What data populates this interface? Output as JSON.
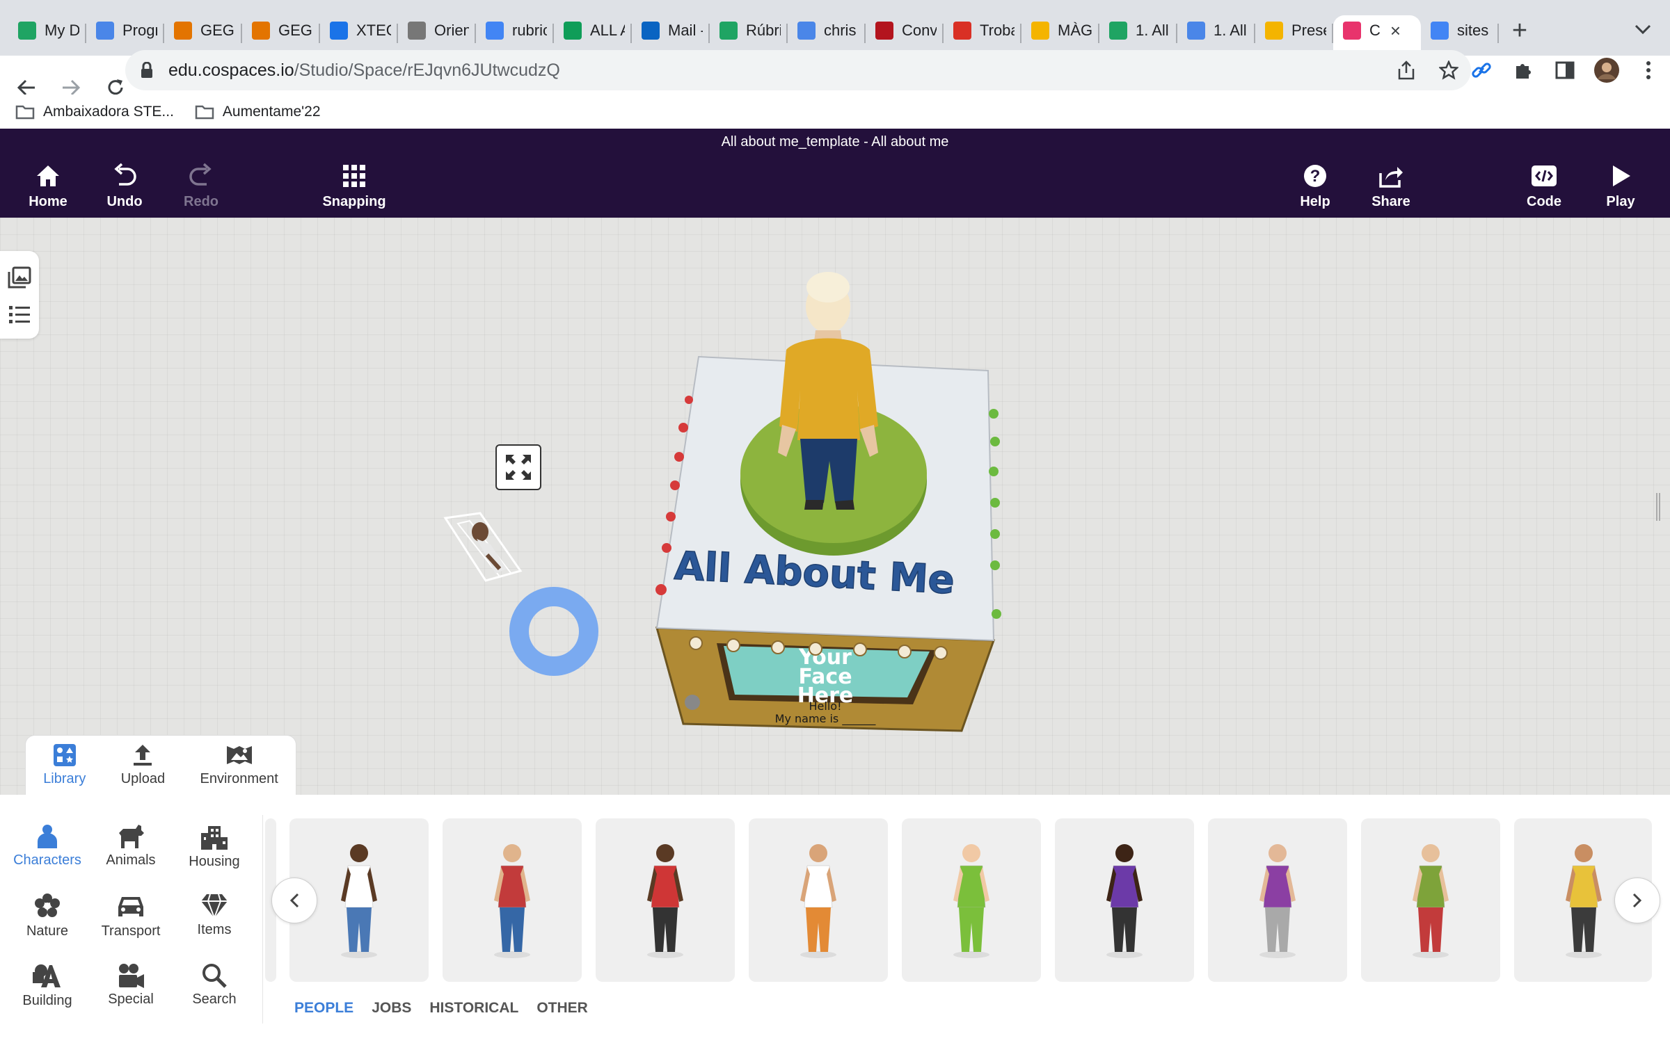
{
  "browser": {
    "tabs": [
      {
        "label": "My D",
        "icon": "google-drive-icon",
        "color": "#1fa463"
      },
      {
        "label": "Progr",
        "icon": "google-docs-icon",
        "color": "#4a86e8"
      },
      {
        "label": "GEG",
        "icon": "geg-icon",
        "color": "#e37400"
      },
      {
        "label": "GEG",
        "icon": "geg-icon",
        "color": "#e37400"
      },
      {
        "label": "XTEC",
        "icon": "calendar-icon",
        "color": "#1a73e8"
      },
      {
        "label": "Orien",
        "icon": "wordpress-icon",
        "color": "#777777"
      },
      {
        "label": "rubric",
        "icon": "google-search-icon",
        "color": "#4285f4"
      },
      {
        "label": "ALL A",
        "icon": "google-sheets-icon",
        "color": "#0f9d58"
      },
      {
        "label": "Mail -",
        "icon": "outlook-icon",
        "color": "#0a64c2"
      },
      {
        "label": "Rúbri",
        "icon": "google-drive-icon",
        "color": "#1fa463"
      },
      {
        "label": "chris",
        "icon": "google-docs-icon",
        "color": "#4a86e8"
      },
      {
        "label": "Conv",
        "icon": "pdf-icon",
        "color": "#b3141e"
      },
      {
        "label": "Troba",
        "icon": "gmail-icon",
        "color": "#d93025"
      },
      {
        "label": "MÀGI",
        "icon": "google-slides-icon",
        "color": "#f4b400"
      },
      {
        "label": "1. All",
        "icon": "google-drive-icon",
        "color": "#1fa463"
      },
      {
        "label": "1. All",
        "icon": "google-docs-icon",
        "color": "#4a86e8"
      },
      {
        "label": "Prese",
        "icon": "google-slides-icon",
        "color": "#f4b400"
      },
      {
        "label": "C",
        "icon": "cospaces-icon",
        "color": "#e8336c",
        "active": true
      },
      {
        "label": "sites",
        "icon": "google-search-icon",
        "color": "#4285f4"
      }
    ],
    "url_host": "edu.cospaces.io",
    "url_path": "/Studio/Space/rEJqvn6JUtwcudzQ",
    "bookmarks": [
      "Ambaixadora STE...",
      "Aumentame'22"
    ]
  },
  "app": {
    "doc_title": "All about me_template - All about me",
    "toolbar": {
      "home": "Home",
      "undo": "Undo",
      "redo": "Redo",
      "snapping": "Snapping",
      "help": "Help",
      "share": "Share",
      "code": "Code",
      "play": "Play"
    },
    "scene": {
      "title_text": "All About Me",
      "sign_text": [
        "Your",
        "Face",
        "Here"
      ],
      "name_text": [
        "Hello!",
        "My name is ______"
      ]
    },
    "library_tabs": [
      "Library",
      "Upload",
      "Environment"
    ],
    "active_library_tab": "Library",
    "categories": [
      "Characters",
      "Animals",
      "Housing",
      "Nature",
      "Transport",
      "Items",
      "Building",
      "Special",
      "Search"
    ],
    "active_category": "Characters",
    "characters": [
      {
        "shirt": "#ffffff",
        "pants": "#4a78b5",
        "skin": "#5a3a24"
      },
      {
        "shirt": "#c23b3b",
        "pants": "#3567a6",
        "skin": "#e0b48c"
      },
      {
        "shirt": "#cf3636",
        "pants": "#333333",
        "skin": "#5a3a24"
      },
      {
        "shirt": "#ffffff",
        "pants": "#e38a35",
        "skin": "#d9a478"
      },
      {
        "shirt": "#7bbf3b",
        "pants": "#7bbf3b",
        "skin": "#f1c9a5"
      },
      {
        "shirt": "#6c3aa8",
        "pants": "#333333",
        "skin": "#3d2416"
      },
      {
        "shirt": "#8b3fa3",
        "pants": "#a9a9a9",
        "skin": "#e3b897"
      },
      {
        "shirt": "#7ea33a",
        "pants": "#c23b3b",
        "skin": "#e7c09b"
      },
      {
        "shirt": "#e8c23a",
        "pants": "#3b3b3b",
        "skin": "#c98e62"
      }
    ],
    "subcategories": [
      "PEOPLE",
      "JOBS",
      "HISTORICAL",
      "OTHER"
    ],
    "active_subcategory": "PEOPLE"
  },
  "colors": {
    "header_bg": "#23103b",
    "accent": "#3b7ed8",
    "scene_bg": "#e4e4e2",
    "platform_green": "#8db43e",
    "ring_blue": "#7aaaf0",
    "title_blue": "#2b5797"
  }
}
